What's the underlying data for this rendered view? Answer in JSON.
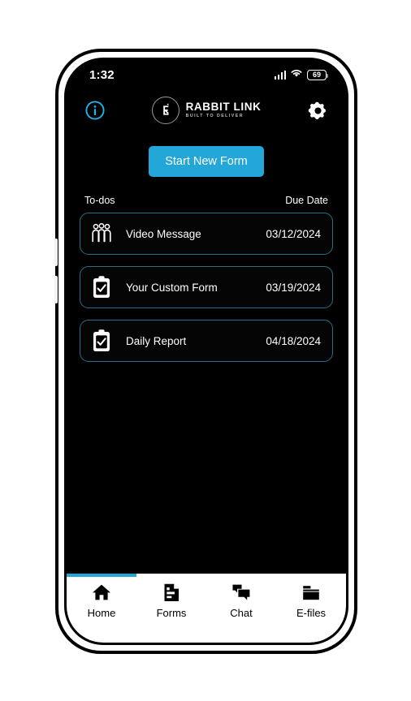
{
  "status_bar": {
    "time": "1:32",
    "signal_icon": "cellular-signal-icon",
    "wifi_icon": "wifi-icon",
    "battery_level": "69"
  },
  "header": {
    "info_icon": "info-circle-icon",
    "settings_icon": "gear-icon",
    "brand_mark_icon": "rabbit-monogram-icon",
    "brand_name": "RABBIT LINK",
    "brand_tagline": "BUILT TO DELIVER"
  },
  "main": {
    "start_new_form_label": "Start New Form",
    "column_headers": {
      "todos": "To-dos",
      "due_date": "Due Date"
    },
    "todos": [
      {
        "icon": "people-group-icon",
        "title": "Video Message",
        "due_date": "03/12/2024"
      },
      {
        "icon": "clipboard-check-icon",
        "title": "Your Custom Form",
        "due_date": "03/19/2024"
      },
      {
        "icon": "clipboard-check-icon",
        "title": "Daily Report",
        "due_date": "04/18/2024"
      }
    ]
  },
  "bottom_nav": {
    "active_index": 0,
    "items": [
      {
        "label": "Home",
        "icon": "home-icon"
      },
      {
        "label": "Forms",
        "icon": "document-icon"
      },
      {
        "label": "Chat",
        "icon": "chat-bubbles-icon"
      },
      {
        "label": "E-files",
        "icon": "folder-icon"
      }
    ]
  },
  "colors": {
    "accent": "#22a7d8",
    "card_border": "#2a6f8a",
    "screen_background": "#000000",
    "nav_background": "#ffffff"
  }
}
